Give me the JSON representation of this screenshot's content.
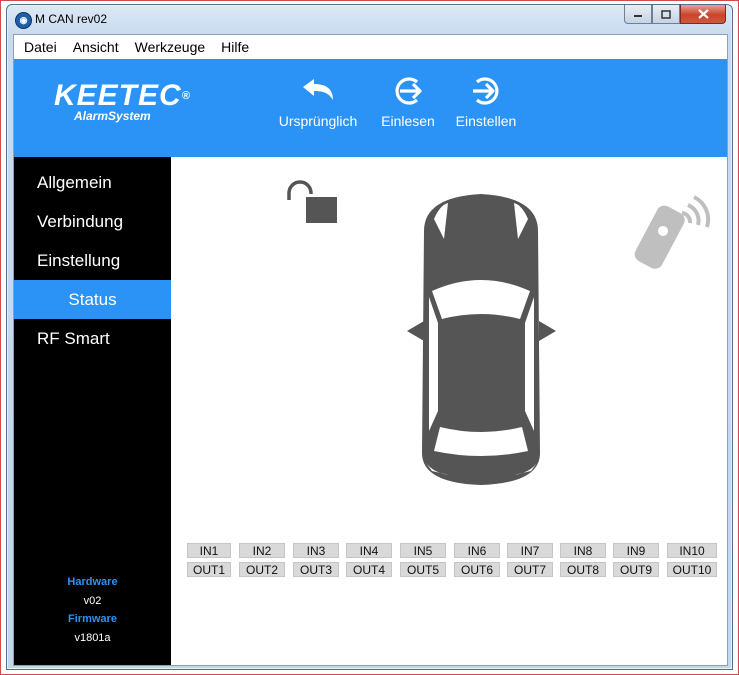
{
  "window": {
    "title": "M CAN rev02",
    "controls": [
      "minimize-icon",
      "maximize-icon",
      "close-icon"
    ]
  },
  "menu": [
    "Datei",
    "Ansicht",
    "Werkzeuge",
    "Hilfe"
  ],
  "brand": {
    "logo_main": "KEETEC",
    "logo_reg": "®",
    "logo_sub": "AlarmSystem"
  },
  "toolbar": {
    "original_label": "Ursprünglich",
    "read_label": "Einlesen",
    "write_label": "Einstellen"
  },
  "sidebar": {
    "items": [
      {
        "label": "Allgemein"
      },
      {
        "label": "Verbindung"
      },
      {
        "label": "Einstellung"
      },
      {
        "label": "Status",
        "active": true
      },
      {
        "label": "RF Smart"
      }
    ],
    "hardware_label": "Hardware",
    "hardware_value": "v02",
    "firmware_label": "Firmware",
    "firmware_value": "v1801a"
  },
  "status": {
    "inputs": [
      "IN1",
      "IN2",
      "IN3",
      "IN4",
      "IN5",
      "IN6",
      "IN7",
      "IN8",
      "IN9",
      "IN10"
    ],
    "outputs": [
      "OUT1",
      "OUT2",
      "OUT3",
      "OUT4",
      "OUT5",
      "OUT6",
      "OUT7",
      "OUT8",
      "OUT9",
      "OUT10"
    ],
    "icons": [
      "unlocked-padlock-icon",
      "car-top-view-icon",
      "remote-signal-icon"
    ]
  },
  "colors": {
    "accent": "#2a93f5",
    "sidebar": "#000000",
    "icon_gray": "#555555",
    "io_bg": "#d9d9d9"
  }
}
